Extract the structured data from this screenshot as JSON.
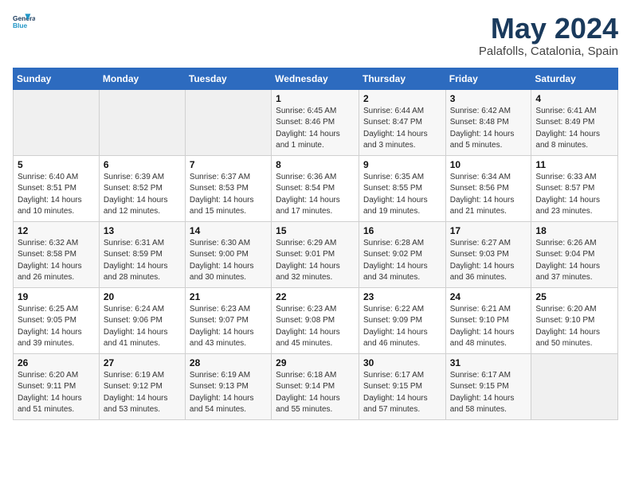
{
  "header": {
    "logo_line1": "General",
    "logo_line2": "Blue",
    "month_title": "May 2024",
    "subtitle": "Palafolls, Catalonia, Spain"
  },
  "days_of_week": [
    "Sunday",
    "Monday",
    "Tuesday",
    "Wednesday",
    "Thursday",
    "Friday",
    "Saturday"
  ],
  "weeks": [
    [
      {
        "day": "",
        "info": ""
      },
      {
        "day": "",
        "info": ""
      },
      {
        "day": "",
        "info": ""
      },
      {
        "day": "1",
        "info": "Sunrise: 6:45 AM\nSunset: 8:46 PM\nDaylight: 14 hours\nand 1 minute."
      },
      {
        "day": "2",
        "info": "Sunrise: 6:44 AM\nSunset: 8:47 PM\nDaylight: 14 hours\nand 3 minutes."
      },
      {
        "day": "3",
        "info": "Sunrise: 6:42 AM\nSunset: 8:48 PM\nDaylight: 14 hours\nand 5 minutes."
      },
      {
        "day": "4",
        "info": "Sunrise: 6:41 AM\nSunset: 8:49 PM\nDaylight: 14 hours\nand 8 minutes."
      }
    ],
    [
      {
        "day": "5",
        "info": "Sunrise: 6:40 AM\nSunset: 8:51 PM\nDaylight: 14 hours\nand 10 minutes."
      },
      {
        "day": "6",
        "info": "Sunrise: 6:39 AM\nSunset: 8:52 PM\nDaylight: 14 hours\nand 12 minutes."
      },
      {
        "day": "7",
        "info": "Sunrise: 6:37 AM\nSunset: 8:53 PM\nDaylight: 14 hours\nand 15 minutes."
      },
      {
        "day": "8",
        "info": "Sunrise: 6:36 AM\nSunset: 8:54 PM\nDaylight: 14 hours\nand 17 minutes."
      },
      {
        "day": "9",
        "info": "Sunrise: 6:35 AM\nSunset: 8:55 PM\nDaylight: 14 hours\nand 19 minutes."
      },
      {
        "day": "10",
        "info": "Sunrise: 6:34 AM\nSunset: 8:56 PM\nDaylight: 14 hours\nand 21 minutes."
      },
      {
        "day": "11",
        "info": "Sunrise: 6:33 AM\nSunset: 8:57 PM\nDaylight: 14 hours\nand 23 minutes."
      }
    ],
    [
      {
        "day": "12",
        "info": "Sunrise: 6:32 AM\nSunset: 8:58 PM\nDaylight: 14 hours\nand 26 minutes."
      },
      {
        "day": "13",
        "info": "Sunrise: 6:31 AM\nSunset: 8:59 PM\nDaylight: 14 hours\nand 28 minutes."
      },
      {
        "day": "14",
        "info": "Sunrise: 6:30 AM\nSunset: 9:00 PM\nDaylight: 14 hours\nand 30 minutes."
      },
      {
        "day": "15",
        "info": "Sunrise: 6:29 AM\nSunset: 9:01 PM\nDaylight: 14 hours\nand 32 minutes."
      },
      {
        "day": "16",
        "info": "Sunrise: 6:28 AM\nSunset: 9:02 PM\nDaylight: 14 hours\nand 34 minutes."
      },
      {
        "day": "17",
        "info": "Sunrise: 6:27 AM\nSunset: 9:03 PM\nDaylight: 14 hours\nand 36 minutes."
      },
      {
        "day": "18",
        "info": "Sunrise: 6:26 AM\nSunset: 9:04 PM\nDaylight: 14 hours\nand 37 minutes."
      }
    ],
    [
      {
        "day": "19",
        "info": "Sunrise: 6:25 AM\nSunset: 9:05 PM\nDaylight: 14 hours\nand 39 minutes."
      },
      {
        "day": "20",
        "info": "Sunrise: 6:24 AM\nSunset: 9:06 PM\nDaylight: 14 hours\nand 41 minutes."
      },
      {
        "day": "21",
        "info": "Sunrise: 6:23 AM\nSunset: 9:07 PM\nDaylight: 14 hours\nand 43 minutes."
      },
      {
        "day": "22",
        "info": "Sunrise: 6:23 AM\nSunset: 9:08 PM\nDaylight: 14 hours\nand 45 minutes."
      },
      {
        "day": "23",
        "info": "Sunrise: 6:22 AM\nSunset: 9:09 PM\nDaylight: 14 hours\nand 46 minutes."
      },
      {
        "day": "24",
        "info": "Sunrise: 6:21 AM\nSunset: 9:10 PM\nDaylight: 14 hours\nand 48 minutes."
      },
      {
        "day": "25",
        "info": "Sunrise: 6:20 AM\nSunset: 9:10 PM\nDaylight: 14 hours\nand 50 minutes."
      }
    ],
    [
      {
        "day": "26",
        "info": "Sunrise: 6:20 AM\nSunset: 9:11 PM\nDaylight: 14 hours\nand 51 minutes."
      },
      {
        "day": "27",
        "info": "Sunrise: 6:19 AM\nSunset: 9:12 PM\nDaylight: 14 hours\nand 53 minutes."
      },
      {
        "day": "28",
        "info": "Sunrise: 6:19 AM\nSunset: 9:13 PM\nDaylight: 14 hours\nand 54 minutes."
      },
      {
        "day": "29",
        "info": "Sunrise: 6:18 AM\nSunset: 9:14 PM\nDaylight: 14 hours\nand 55 minutes."
      },
      {
        "day": "30",
        "info": "Sunrise: 6:17 AM\nSunset: 9:15 PM\nDaylight: 14 hours\nand 57 minutes."
      },
      {
        "day": "31",
        "info": "Sunrise: 6:17 AM\nSunset: 9:15 PM\nDaylight: 14 hours\nand 58 minutes."
      },
      {
        "day": "",
        "info": ""
      }
    ]
  ]
}
